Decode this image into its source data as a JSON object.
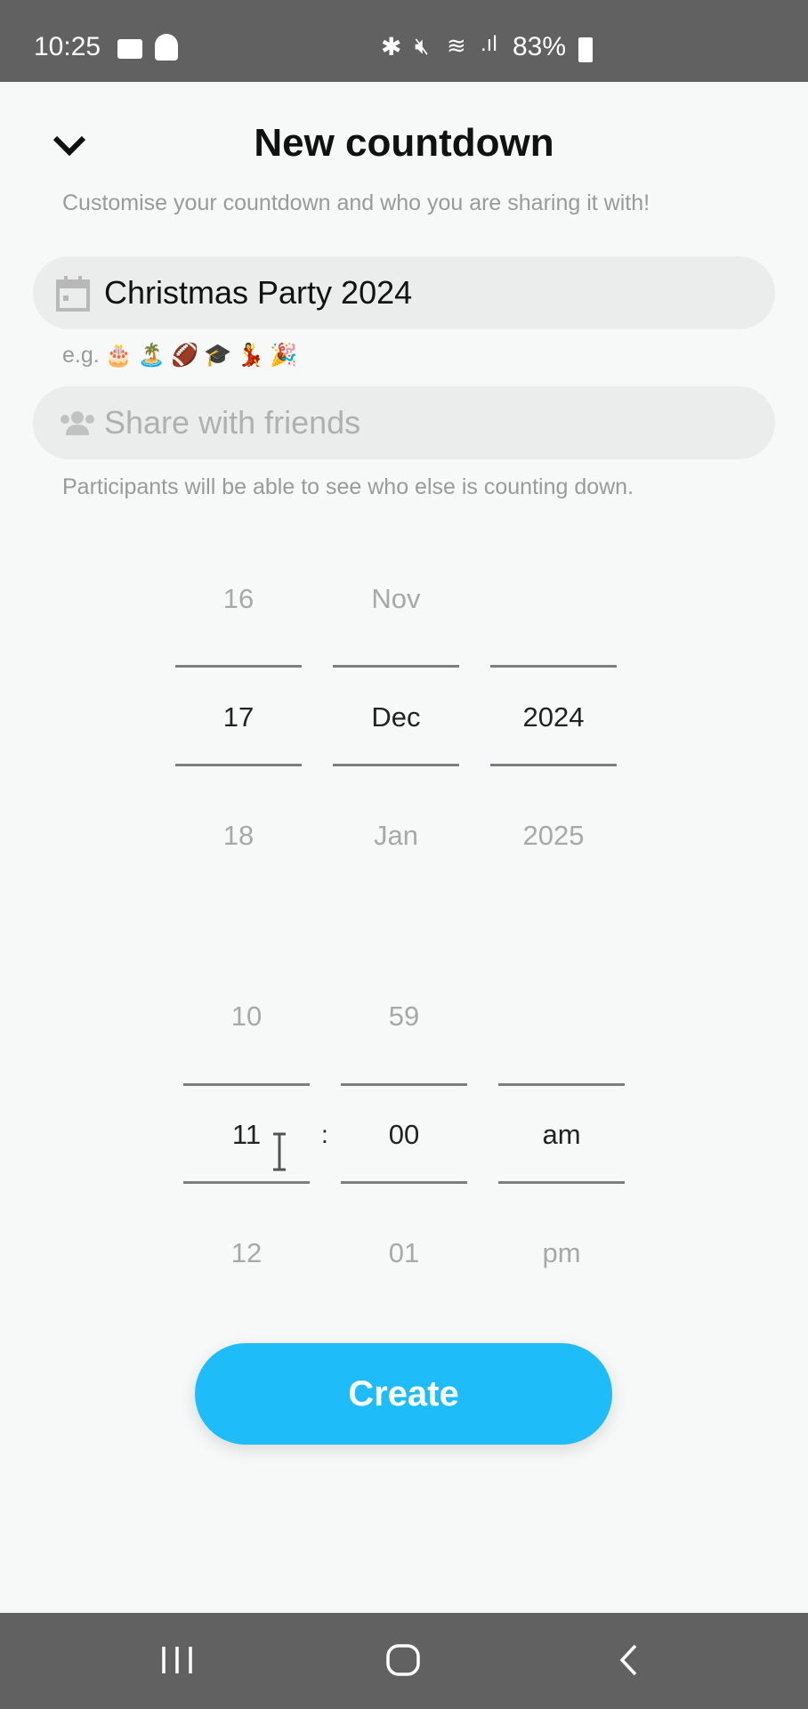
{
  "status_bar": {
    "time": "10:25",
    "battery": "83%",
    "icons": [
      "video-icon",
      "snapchat-ghost-icon",
      "bluetooth-icon",
      "mute-icon",
      "wifi-icon",
      "signal-icon",
      "battery-icon"
    ]
  },
  "header": {
    "title": "New countdown",
    "subtitle": "Customise your countdown and who you are sharing it with!"
  },
  "name_field": {
    "value": "Christmas Party 2024",
    "icon": "calendar-icon"
  },
  "examples": {
    "label": "e.g.",
    "emojis": [
      "🎂",
      "🏝️",
      "🏈",
      "🎓",
      "💃",
      "🎉"
    ]
  },
  "share_field": {
    "placeholder": "Share with friends",
    "icon": "friends-icon"
  },
  "share_note": "Participants will be able to see who else is counting down.",
  "date_picker": {
    "day": {
      "prev": "16",
      "selected": "17",
      "next": "18"
    },
    "month": {
      "prev": "Nov",
      "selected": "Dec",
      "next": "Jan"
    },
    "year": {
      "prev": "",
      "selected": "2024",
      "next": "2025"
    }
  },
  "time_picker": {
    "hour": {
      "prev": "10",
      "selected": "11",
      "next": "12"
    },
    "separator": ":",
    "minute": {
      "prev": "59",
      "selected": "00",
      "next": "01"
    },
    "period": {
      "prev": "",
      "selected": "am",
      "next": "pm"
    }
  },
  "create_label": "Create",
  "colors": {
    "accent": "#1fbcfa",
    "system_bars": "#616161",
    "background": "#f7f8f8"
  }
}
